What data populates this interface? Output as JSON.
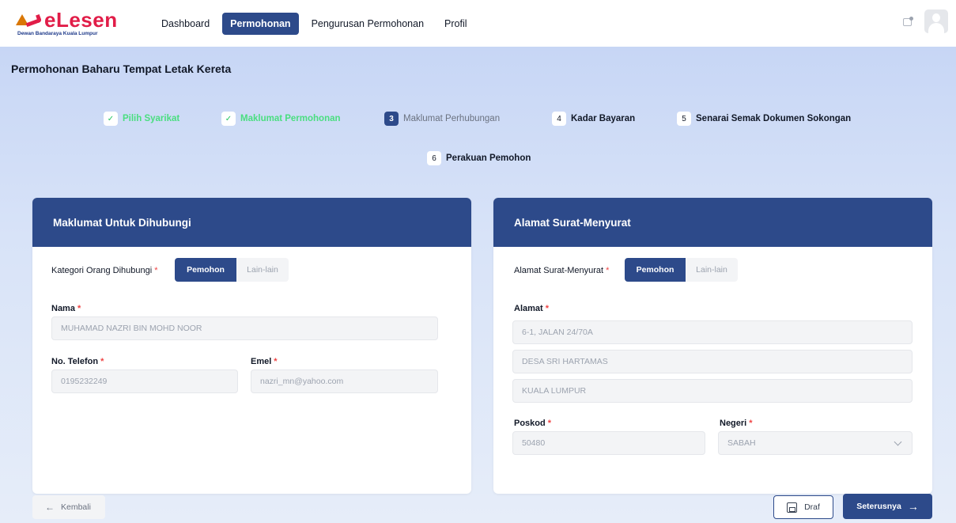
{
  "brand": {
    "name": "eLesen",
    "subtitle": "Dewan Bandaraya Kuala Lumpur"
  },
  "nav": {
    "items": [
      {
        "label": "Dashboard",
        "active": false
      },
      {
        "label": "Permohonan",
        "active": true
      },
      {
        "label": "Pengurusan Permohonan",
        "active": false
      },
      {
        "label": "Profil",
        "active": false
      }
    ]
  },
  "page": {
    "title": "Permohonan Baharu Tempat Letak Kereta"
  },
  "steps": [
    {
      "badge": "✓",
      "label": "Pilih Syarikat",
      "state": "done"
    },
    {
      "badge": "✓",
      "label": "Maklumat Permohonan",
      "state": "done"
    },
    {
      "badge": "3",
      "label": "Maklumat Perhubungan",
      "state": "current"
    },
    {
      "badge": "4",
      "label": "Kadar Bayaran",
      "state": "next"
    },
    {
      "badge": "5",
      "label": "Senarai Semak Dokumen Sokongan",
      "state": "next"
    },
    {
      "badge": "6",
      "label": "Perakuan Pemohon",
      "state": "next"
    }
  ],
  "contact": {
    "title": "Maklumat Untuk Dihubungi",
    "kategori_label": "Kategori Orang Dihubungi",
    "options": [
      "Pemohon",
      "Lain-lain"
    ],
    "selected": "Pemohon",
    "nama_label": "Nama",
    "nama_value": "MUHAMAD NAZRI BIN MOHD NOOR",
    "telefon_label": "No. Telefon",
    "telefon_value": "0195232249",
    "emel_label": "Emel",
    "emel_value": "nazri_mn@yahoo.com",
    "required_mark": "*"
  },
  "address": {
    "title": "Alamat Surat-Menyurat",
    "type_label": "Alamat Surat-Menyurat",
    "options": [
      "Pemohon",
      "Lain-lain"
    ],
    "selected": "Pemohon",
    "alamat_label": "Alamat",
    "line1": "6-1, JALAN 24/70A",
    "line2": "DESA SRI HARTAMAS",
    "line3": "KUALA LUMPUR",
    "poskod_label": "Poskod",
    "poskod_value": "50480",
    "negeri_label": "Negeri",
    "negeri_value": "SABAH"
  },
  "actions": {
    "back": "Kembali",
    "draft": "Draf",
    "next": "Seterusnya"
  },
  "colors": {
    "primary": "#2d4a8a",
    "done": "#4ade80",
    "required": "#ef4444",
    "brand": "#e11d48"
  }
}
